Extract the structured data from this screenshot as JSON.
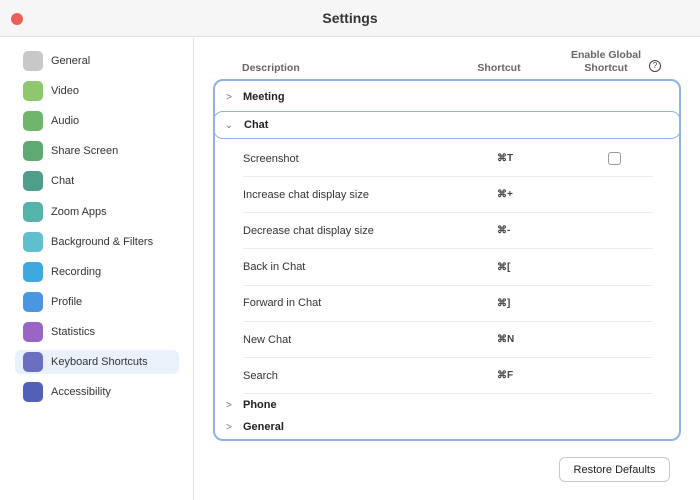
{
  "window": {
    "title": "Settings"
  },
  "sidebar": {
    "items": [
      {
        "label": "General",
        "icon": "gear-icon",
        "color": "#c8c8c8"
      },
      {
        "label": "Video",
        "icon": "video-camera-icon",
        "color": "#8fc76f"
      },
      {
        "label": "Audio",
        "icon": "headphones-icon",
        "color": "#6fb56c"
      },
      {
        "label": "Share Screen",
        "icon": "share-screen-icon",
        "color": "#5faa72"
      },
      {
        "label": "Chat",
        "icon": "chat-bubble-icon",
        "color": "#4f9e8c"
      },
      {
        "label": "Zoom Apps",
        "icon": "zoom-apps-icon",
        "color": "#55b3a8"
      },
      {
        "label": "Background & Filters",
        "icon": "background-icon",
        "color": "#5fbfcf"
      },
      {
        "label": "Recording",
        "icon": "recording-icon",
        "color": "#3fa8e0"
      },
      {
        "label": "Profile",
        "icon": "profile-icon",
        "color": "#4a96e0"
      },
      {
        "label": "Statistics",
        "icon": "statistics-icon",
        "color": "#9a66c6"
      },
      {
        "label": "Keyboard Shortcuts",
        "icon": "keyboard-icon",
        "color": "#6a6fc0",
        "selected": true
      },
      {
        "label": "Accessibility",
        "icon": "accessibility-icon",
        "color": "#5460b8"
      }
    ]
  },
  "main": {
    "headers": {
      "description": "Description",
      "shortcut": "Shortcut",
      "global_line1": "Enable Global",
      "global_line2": "Shortcut",
      "help": "?"
    },
    "groups": {
      "meeting": "Meeting",
      "chat": "Chat",
      "phone": "Phone",
      "general": "General"
    },
    "chat_rows": [
      {
        "label": "Screenshot",
        "shortcut": "⌘T",
        "global_checkbox": false
      },
      {
        "label": "Increase chat display size",
        "shortcut": "⌘+"
      },
      {
        "label": "Decrease chat display size",
        "shortcut": "⌘-"
      },
      {
        "label": "Back in Chat",
        "shortcut": "⌘["
      },
      {
        "label": "Forward in Chat",
        "shortcut": "⌘]"
      },
      {
        "label": "New Chat",
        "shortcut": "⌘N"
      },
      {
        "label": "Search",
        "shortcut": "⌘F"
      }
    ],
    "restore_label": "Restore Defaults",
    "accent": "#8db3e2"
  }
}
